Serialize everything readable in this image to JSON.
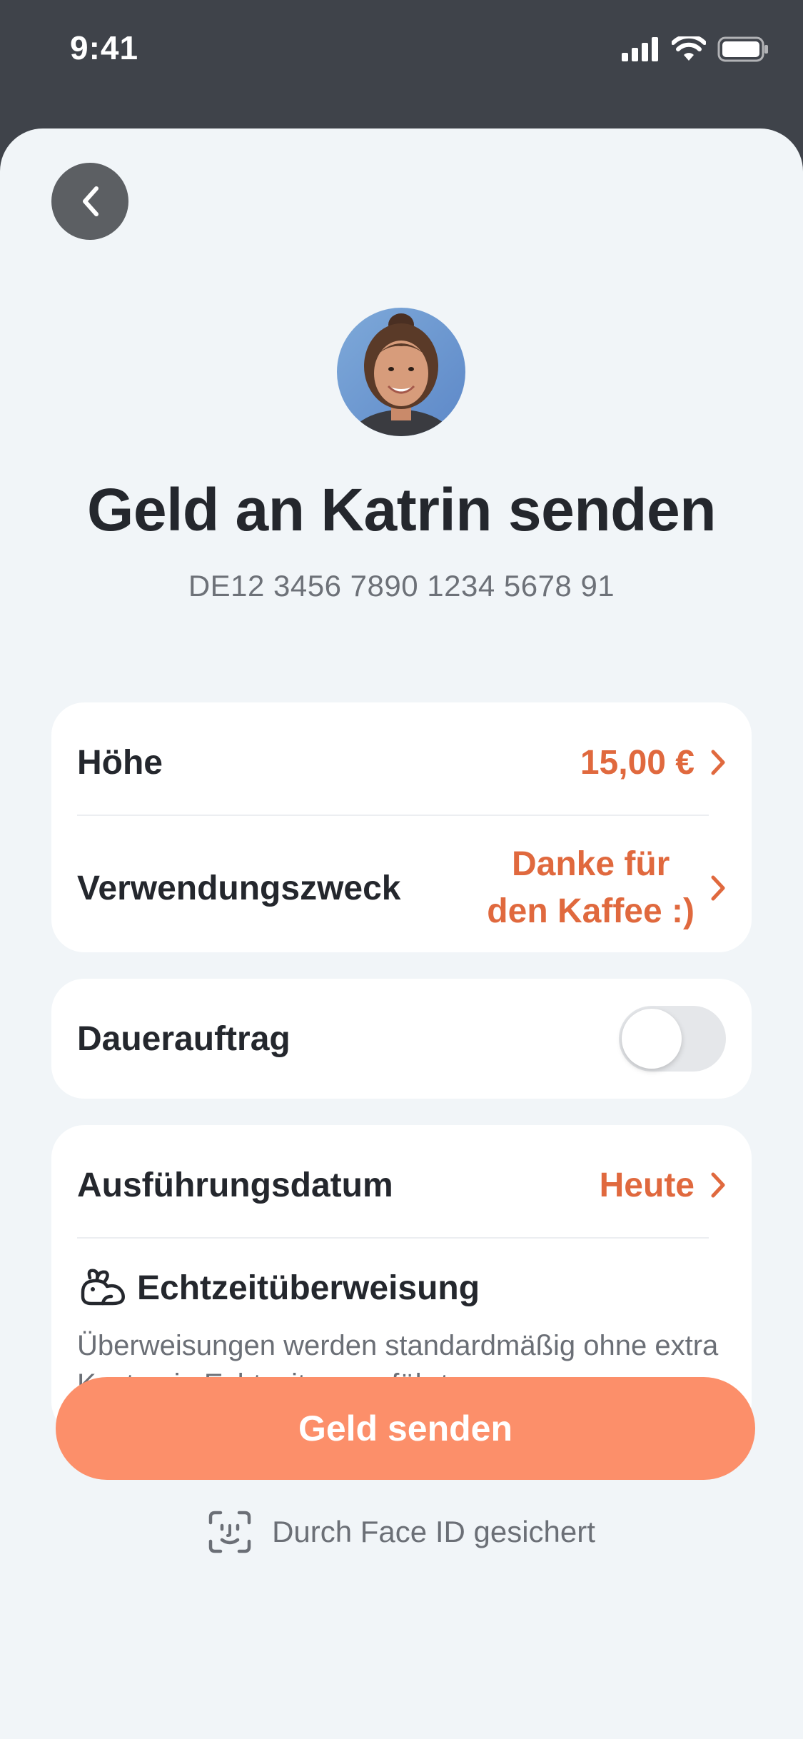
{
  "status_bar": {
    "time": "9:41",
    "icons": [
      "cellular-signal-icon",
      "wifi-icon",
      "battery-icon"
    ]
  },
  "header": {
    "back_icon": "chevron-left-icon"
  },
  "recipient": {
    "avatar": "avatar-photo",
    "title": "Geld an Katrin senden",
    "iban": "DE12 3456 7890 1234 5678 91"
  },
  "details": {
    "amount_label": "Höhe",
    "amount_value": "15,00 €",
    "purpose_label": "Verwendungszweck",
    "purpose_value_line1": "Danke für",
    "purpose_value_line2": "den Kaffee :)"
  },
  "standing_order": {
    "label": "Dauerauftrag",
    "enabled": false
  },
  "execution": {
    "date_label": "Ausführungsdatum",
    "date_value": "Heute",
    "realtime_icon": "rabbit-icon",
    "realtime_title": "Echtzeitüberweisung",
    "realtime_description": "Überweisungen werden standardmäßig ohne extra Kosten in Echtzeit ausgeführt"
  },
  "action": {
    "send_label": "Geld senden"
  },
  "security": {
    "icon": "face-id-icon",
    "text": "Durch Face ID gesichert"
  },
  "colors": {
    "accent": "#e0693e",
    "button": "#fc8f6a",
    "background": "#f1f5f8",
    "status_bar": "#3f434a"
  }
}
